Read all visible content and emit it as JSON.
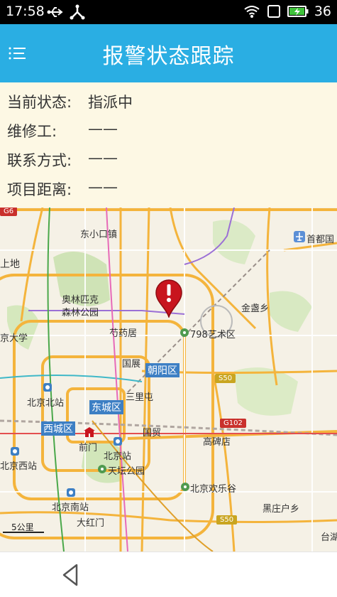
{
  "status_bar": {
    "time": "17:58",
    "battery_level": "36"
  },
  "app_bar": {
    "title": "报警状态跟踪"
  },
  "info": {
    "rows": [
      {
        "label": "当前状态:",
        "value": "指派中"
      },
      {
        "label": "维修工:",
        "value": "——"
      },
      {
        "label": "联系方式:",
        "value": "——"
      },
      {
        "label": "项目距离:",
        "value": "——"
      }
    ]
  },
  "map": {
    "places": {
      "dongxiaokou": "东小口镇",
      "capital_airport": "首都国",
      "shangdi": "上地",
      "olympic_forest": "奥林匹克",
      "olympic_forest_2": "森林公园",
      "jinzhan": "金盏乡",
      "daxue": "京大学",
      "shaoyaoju": "芍药居",
      "art_district": "798艺术区",
      "guozhan": "国展",
      "beijing_north_station": "北京北站",
      "sanlitun": "三里屯",
      "guomao": "国贸",
      "gaobeidian": "高碑店",
      "qianmen": "前门",
      "beijing_station": "北京站",
      "tiantan_park": "天坛公园",
      "beijing_west_station": "北京西站",
      "happy_valley": "北京欢乐谷",
      "beijing_south_station": "北京南站",
      "heizhuanghu": "黑庄户乡",
      "dahongmen": "大红门",
      "taihu": "台湖"
    },
    "districts": {
      "chaoyang": "朝阳区",
      "dongcheng": "东城区",
      "xicheng": "西城区"
    },
    "roads": {
      "g6": "G6",
      "s50_1": "S50",
      "g102": "G102",
      "s50_2": "S50"
    },
    "scale": "5公里",
    "colors": {
      "marker": "#c8151e",
      "district_badge": "#3d7fc4",
      "expressway": "#f4b43c",
      "app_bar": "#2aaee3",
      "info_bg": "#fdf8e4"
    }
  }
}
